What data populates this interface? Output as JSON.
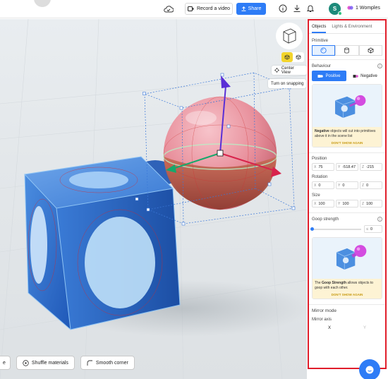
{
  "topbar": {
    "record_label": "Record a video",
    "share_label": "Share",
    "user_initial": "S",
    "workspace_label": "1 Womples"
  },
  "viewport": {
    "center_view_label": "Center View",
    "snapping_label": "Turn on snapping",
    "tools": [
      {
        "label": "e"
      },
      {
        "label": "Shuffle materials"
      },
      {
        "label": "Smooth corner"
      }
    ]
  },
  "panel": {
    "tabs": [
      "Objects",
      "Lights & Environment"
    ],
    "primitive_label": "Primitive",
    "behaviour_label": "Behaviour",
    "behaviour_positive": "Positive",
    "behaviour_negative": "Negative",
    "negative_info_bold": "Negative",
    "negative_info_rest": " objects will cut into primitives above it in the scene list",
    "dont_show_again": "DON'T SHOW AGAIN",
    "position_label": "Position",
    "position": {
      "x": "75",
      "y": "-518.47",
      "z": "-215"
    },
    "rotation_label": "Rotation",
    "rotation": {
      "x": "0",
      "y": "0",
      "z": "0"
    },
    "size_label": "Size",
    "size": {
      "x": "100",
      "y": "100",
      "z": "100"
    },
    "goop_label": "Goop strength",
    "goop_value": "0",
    "goop_value_prefix": "≤",
    "goop_info_pre": "The ",
    "goop_info_bold": "Goop Strength",
    "goop_info_rest": " allows objects to goop with each other.",
    "mirror_mode_label": "Mirror mode",
    "mirror_axis_label": "Mirror axis",
    "mirror_axis": [
      "X",
      "Y"
    ]
  },
  "colors": {
    "accent": "#2e7cf6",
    "highlight_border": "#e01e2b",
    "cube": "#2f6fd0",
    "sphere": "#e58a96"
  },
  "icons": [
    "cloud-check-icon",
    "video-icon",
    "upload-icon",
    "info-icon",
    "download-icon",
    "bell-icon",
    "sphere-icon",
    "cylinder-icon",
    "box-icon",
    "chat-icon"
  ]
}
